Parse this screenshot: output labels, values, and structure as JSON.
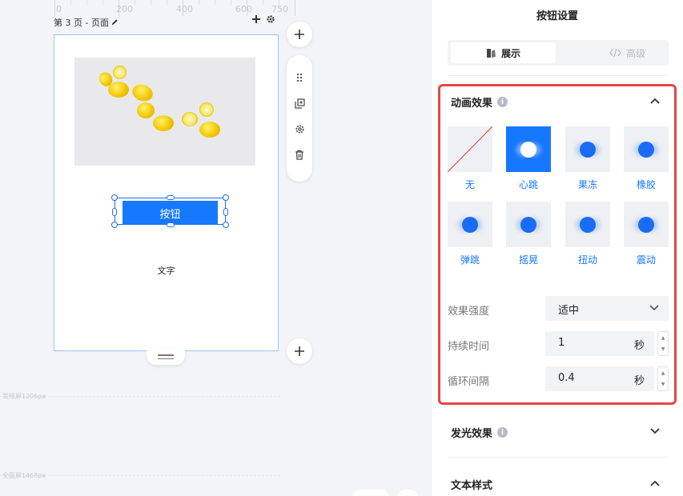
{
  "ruler": {
    "ticks": [
      "0",
      "200",
      "400",
      "600",
      "750"
    ]
  },
  "page": {
    "label": "第 3 页 - 页面"
  },
  "canvas": {
    "button_text": "按钮",
    "text_element": "文字",
    "screen_lines": [
      "常规屏1206px",
      "全面屏1468px"
    ]
  },
  "panel": {
    "title": "按钮设置",
    "tabs": [
      {
        "label": "展示",
        "icon": "style-icon",
        "active": true
      },
      {
        "label": "高级",
        "icon": "code-icon",
        "active": false
      }
    ],
    "animation": {
      "heading": "动画效果",
      "effects": [
        {
          "label": "无",
          "selected": false
        },
        {
          "label": "心跳",
          "selected": true
        },
        {
          "label": "果冻",
          "selected": false
        },
        {
          "label": "橡胶",
          "selected": false
        },
        {
          "label": "弹跳",
          "selected": false
        },
        {
          "label": "摇晃",
          "selected": false
        },
        {
          "label": "扭动",
          "selected": false
        },
        {
          "label": "震动",
          "selected": false
        }
      ],
      "intensity_label": "效果强度",
      "intensity_value": "适中",
      "duration_label": "持续时间",
      "duration_value": "1",
      "duration_unit": "秒",
      "interval_label": "循环间隔",
      "interval_value": "0.4",
      "interval_unit": "秒"
    },
    "glow": {
      "heading": "发光效果"
    },
    "text_style": {
      "heading": "文本样式"
    }
  },
  "colors": {
    "accent": "#1677ff",
    "highlight_border": "#e64545"
  }
}
